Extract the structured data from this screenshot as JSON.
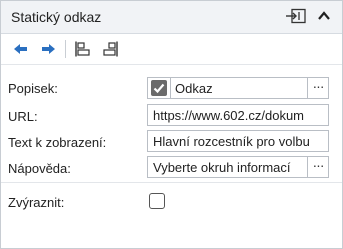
{
  "header": {
    "title": "Statický odkaz",
    "undock_icon": "undock-icon",
    "collapse_icon": "chevron-up-icon"
  },
  "toolbar": {
    "buttons": [
      {
        "icon": "arrow-left-icon",
        "color": "#2a6fc0"
      },
      {
        "icon": "arrow-right-icon",
        "color": "#2a6fc0"
      },
      {
        "icon": "align-left-icon"
      },
      {
        "icon": "align-right-icon"
      }
    ]
  },
  "form": {
    "popisek": {
      "label": "Popisek:",
      "checked": true,
      "value": "Odkaz",
      "more": "···"
    },
    "url": {
      "label": "URL:",
      "value": "https://www.602.cz/dokum"
    },
    "text": {
      "label": "Text k zobrazení:",
      "value": "Hlavní rozcestník pro volbu"
    },
    "napoveda": {
      "label": "Nápověda:",
      "value": "Vyberte okruh informací",
      "more": "···"
    },
    "zvyraznit": {
      "label": "Zvýraznit:",
      "checked": false
    }
  }
}
